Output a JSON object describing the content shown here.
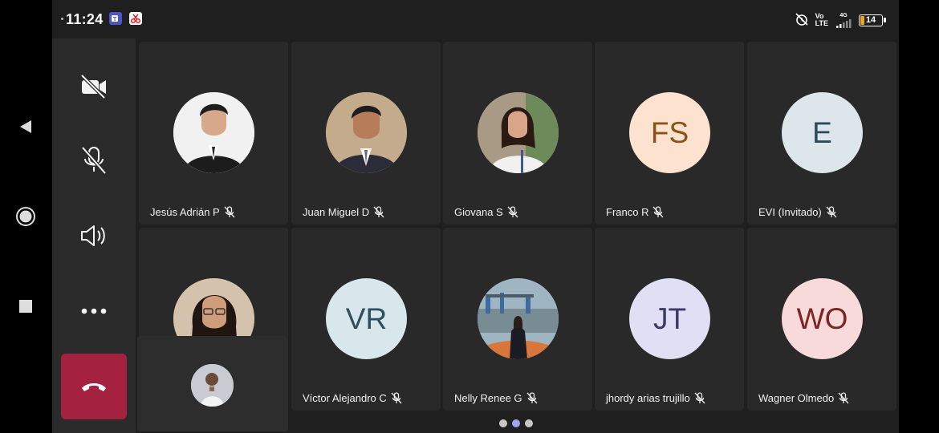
{
  "status": {
    "time": "11:24",
    "network_top": "Vo",
    "network_bottom": "LTE",
    "signal_label": "4G",
    "battery": "14"
  },
  "controls": {
    "camera": "camera-off-icon",
    "mic": "mic-off-icon",
    "speaker": "speaker-icon",
    "more": "more-icon",
    "hangup": "hang-up-icon",
    "hangup_color": "#a4213f"
  },
  "participants": [
    {
      "name": "Jesús Adrián P",
      "initials": "",
      "avatar_bg": "#e8e8e8",
      "photo": true
    },
    {
      "name": "Juan Miguel D",
      "initials": "",
      "avatar_bg": "#b39b7e",
      "photo": true
    },
    {
      "name": "Giovana S",
      "initials": "",
      "avatar_bg": "#c9b8a4",
      "photo": true
    },
    {
      "name": "Franco R",
      "initials": "FS",
      "avatar_bg": "#fde3cf",
      "initials_color": "#8a5418"
    },
    {
      "name": "EVI (Invitado)",
      "initials": "E",
      "avatar_bg": "#dde6ea",
      "initials_color": "#2d4958"
    },
    {
      "name": "",
      "initials": "",
      "avatar_bg": "#d9c8b5",
      "photo": true
    },
    {
      "name": "Víctor Alejandro C",
      "initials": "VR",
      "avatar_bg": "#d7e7ec",
      "initials_color": "#2e4e5c"
    },
    {
      "name": "Nelly Renee G",
      "initials": "",
      "avatar_bg": "#7f9aa6",
      "photo": true
    },
    {
      "name": "jhordy arias trujillo",
      "initials": "JT",
      "avatar_bg": "#e1dff3",
      "initials_color": "#3b3a66"
    },
    {
      "name": "Wagner Olmedo",
      "initials": "WO",
      "avatar_bg": "#f8dada",
      "initials_color": "#7d2424"
    }
  ],
  "pager": {
    "count": 3,
    "active": 1
  }
}
